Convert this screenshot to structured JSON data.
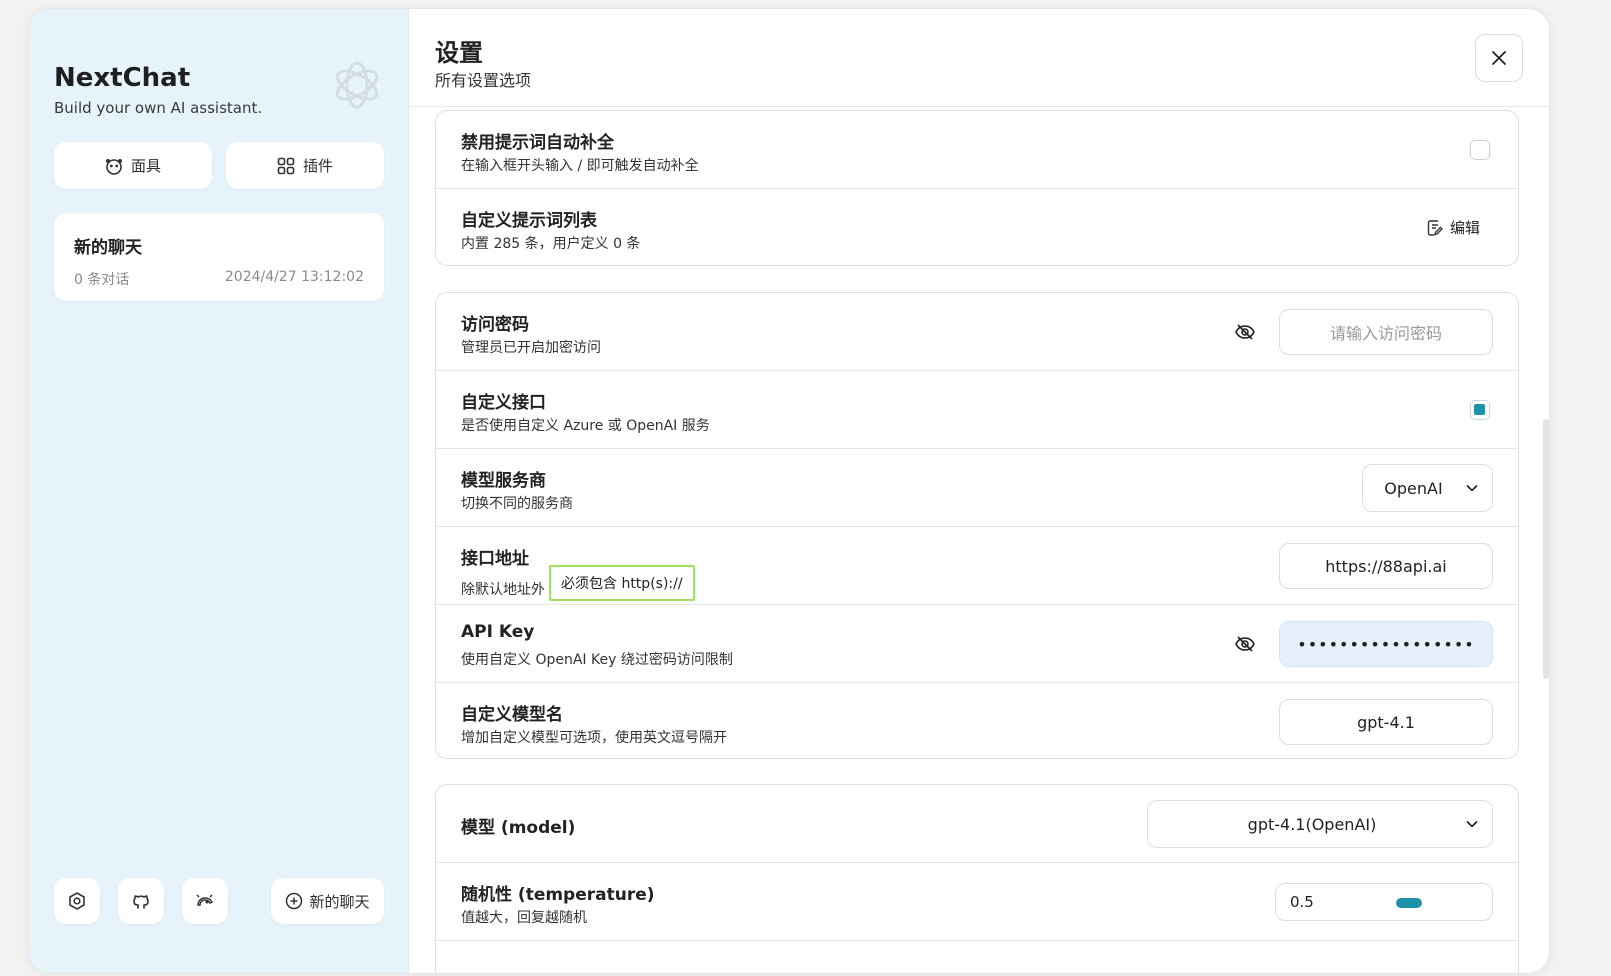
{
  "sidebar": {
    "brand_title": "NextChat",
    "brand_subtitle": "Build your own AI assistant.",
    "mask_button": "面具",
    "plugin_button": "插件",
    "chat": {
      "title": "新的聊天",
      "count": "0 条对话",
      "time": "2024/4/27 13:12:02"
    },
    "new_chat_button": "新的聊天"
  },
  "header": {
    "title": "设置",
    "subtitle": "所有设置选项"
  },
  "prompt_section": {
    "disable_autocomplete": {
      "title": "禁用提示词自动补全",
      "desc": "在输入框开头输入 / 即可触发自动补全",
      "checked": false
    },
    "custom_prompts": {
      "title": "自定义提示词列表",
      "desc": "内置 285 条，用户定义 0 条",
      "edit_label": "编辑"
    }
  },
  "access_section": {
    "access_code": {
      "title": "访问密码",
      "desc": "管理员已开启加密访问",
      "placeholder": "请输入访问密码"
    },
    "custom_endpoint": {
      "title": "自定义接口",
      "desc": "是否使用自定义 Azure 或 OpenAI 服务",
      "checked": true
    },
    "provider": {
      "title": "模型服务商",
      "desc": "切换不同的服务商",
      "value": "OpenAI"
    },
    "endpoint": {
      "title": "接口地址",
      "desc": "除默认地址外",
      "hint": "必须包含 http(s)://",
      "value": "https://88api.ai"
    },
    "api_key": {
      "title": "API Key",
      "desc": "使用自定义 OpenAI Key 绕过密码访问限制",
      "value": "•••••••••••••••••"
    },
    "custom_models": {
      "title": "自定义模型名",
      "desc": "增加自定义模型可选项，使用英文逗号隔开",
      "value": "gpt-4.1"
    }
  },
  "model_section": {
    "model": {
      "title": "模型 (model)",
      "value": "gpt-4.1(OpenAI)"
    },
    "temperature": {
      "title": "随机性 (temperature)",
      "desc": "值越大，回复越随机",
      "value": "0.5"
    }
  },
  "colors": {
    "accent": "#1d93ab",
    "sidebar_bg": "#e7f3fb",
    "hint_border": "#9ee15a"
  }
}
